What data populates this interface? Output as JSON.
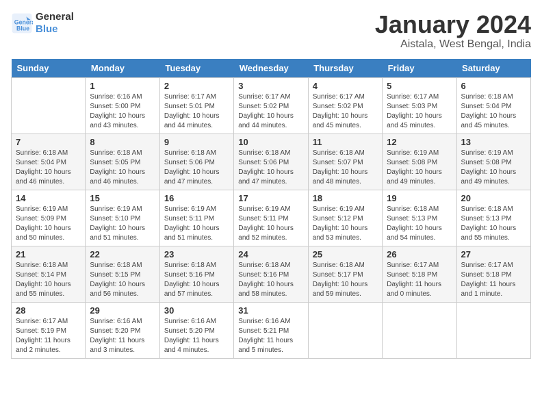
{
  "logo": {
    "line1": "General",
    "line2": "Blue"
  },
  "title": "January 2024",
  "location": "Aistala, West Bengal, India",
  "days_of_week": [
    "Sunday",
    "Monday",
    "Tuesday",
    "Wednesday",
    "Thursday",
    "Friday",
    "Saturday"
  ],
  "weeks": [
    [
      {
        "day": "",
        "info": ""
      },
      {
        "day": "1",
        "info": "Sunrise: 6:16 AM\nSunset: 5:00 PM\nDaylight: 10 hours\nand 43 minutes."
      },
      {
        "day": "2",
        "info": "Sunrise: 6:17 AM\nSunset: 5:01 PM\nDaylight: 10 hours\nand 44 minutes."
      },
      {
        "day": "3",
        "info": "Sunrise: 6:17 AM\nSunset: 5:02 PM\nDaylight: 10 hours\nand 44 minutes."
      },
      {
        "day": "4",
        "info": "Sunrise: 6:17 AM\nSunset: 5:02 PM\nDaylight: 10 hours\nand 45 minutes."
      },
      {
        "day": "5",
        "info": "Sunrise: 6:17 AM\nSunset: 5:03 PM\nDaylight: 10 hours\nand 45 minutes."
      },
      {
        "day": "6",
        "info": "Sunrise: 6:18 AM\nSunset: 5:04 PM\nDaylight: 10 hours\nand 45 minutes."
      }
    ],
    [
      {
        "day": "7",
        "info": "Sunrise: 6:18 AM\nSunset: 5:04 PM\nDaylight: 10 hours\nand 46 minutes."
      },
      {
        "day": "8",
        "info": "Sunrise: 6:18 AM\nSunset: 5:05 PM\nDaylight: 10 hours\nand 46 minutes."
      },
      {
        "day": "9",
        "info": "Sunrise: 6:18 AM\nSunset: 5:06 PM\nDaylight: 10 hours\nand 47 minutes."
      },
      {
        "day": "10",
        "info": "Sunrise: 6:18 AM\nSunset: 5:06 PM\nDaylight: 10 hours\nand 47 minutes."
      },
      {
        "day": "11",
        "info": "Sunrise: 6:18 AM\nSunset: 5:07 PM\nDaylight: 10 hours\nand 48 minutes."
      },
      {
        "day": "12",
        "info": "Sunrise: 6:19 AM\nSunset: 5:08 PM\nDaylight: 10 hours\nand 49 minutes."
      },
      {
        "day": "13",
        "info": "Sunrise: 6:19 AM\nSunset: 5:08 PM\nDaylight: 10 hours\nand 49 minutes."
      }
    ],
    [
      {
        "day": "14",
        "info": "Sunrise: 6:19 AM\nSunset: 5:09 PM\nDaylight: 10 hours\nand 50 minutes."
      },
      {
        "day": "15",
        "info": "Sunrise: 6:19 AM\nSunset: 5:10 PM\nDaylight: 10 hours\nand 51 minutes."
      },
      {
        "day": "16",
        "info": "Sunrise: 6:19 AM\nSunset: 5:11 PM\nDaylight: 10 hours\nand 51 minutes."
      },
      {
        "day": "17",
        "info": "Sunrise: 6:19 AM\nSunset: 5:11 PM\nDaylight: 10 hours\nand 52 minutes."
      },
      {
        "day": "18",
        "info": "Sunrise: 6:19 AM\nSunset: 5:12 PM\nDaylight: 10 hours\nand 53 minutes."
      },
      {
        "day": "19",
        "info": "Sunrise: 6:18 AM\nSunset: 5:13 PM\nDaylight: 10 hours\nand 54 minutes."
      },
      {
        "day": "20",
        "info": "Sunrise: 6:18 AM\nSunset: 5:13 PM\nDaylight: 10 hours\nand 55 minutes."
      }
    ],
    [
      {
        "day": "21",
        "info": "Sunrise: 6:18 AM\nSunset: 5:14 PM\nDaylight: 10 hours\nand 55 minutes."
      },
      {
        "day": "22",
        "info": "Sunrise: 6:18 AM\nSunset: 5:15 PM\nDaylight: 10 hours\nand 56 minutes."
      },
      {
        "day": "23",
        "info": "Sunrise: 6:18 AM\nSunset: 5:16 PM\nDaylight: 10 hours\nand 57 minutes."
      },
      {
        "day": "24",
        "info": "Sunrise: 6:18 AM\nSunset: 5:16 PM\nDaylight: 10 hours\nand 58 minutes."
      },
      {
        "day": "25",
        "info": "Sunrise: 6:18 AM\nSunset: 5:17 PM\nDaylight: 10 hours\nand 59 minutes."
      },
      {
        "day": "26",
        "info": "Sunrise: 6:17 AM\nSunset: 5:18 PM\nDaylight: 11 hours\nand 0 minutes."
      },
      {
        "day": "27",
        "info": "Sunrise: 6:17 AM\nSunset: 5:18 PM\nDaylight: 11 hours\nand 1 minute."
      }
    ],
    [
      {
        "day": "28",
        "info": "Sunrise: 6:17 AM\nSunset: 5:19 PM\nDaylight: 11 hours\nand 2 minutes."
      },
      {
        "day": "29",
        "info": "Sunrise: 6:16 AM\nSunset: 5:20 PM\nDaylight: 11 hours\nand 3 minutes."
      },
      {
        "day": "30",
        "info": "Sunrise: 6:16 AM\nSunset: 5:20 PM\nDaylight: 11 hours\nand 4 minutes."
      },
      {
        "day": "31",
        "info": "Sunrise: 6:16 AM\nSunset: 5:21 PM\nDaylight: 11 hours\nand 5 minutes."
      },
      {
        "day": "",
        "info": ""
      },
      {
        "day": "",
        "info": ""
      },
      {
        "day": "",
        "info": ""
      }
    ]
  ]
}
